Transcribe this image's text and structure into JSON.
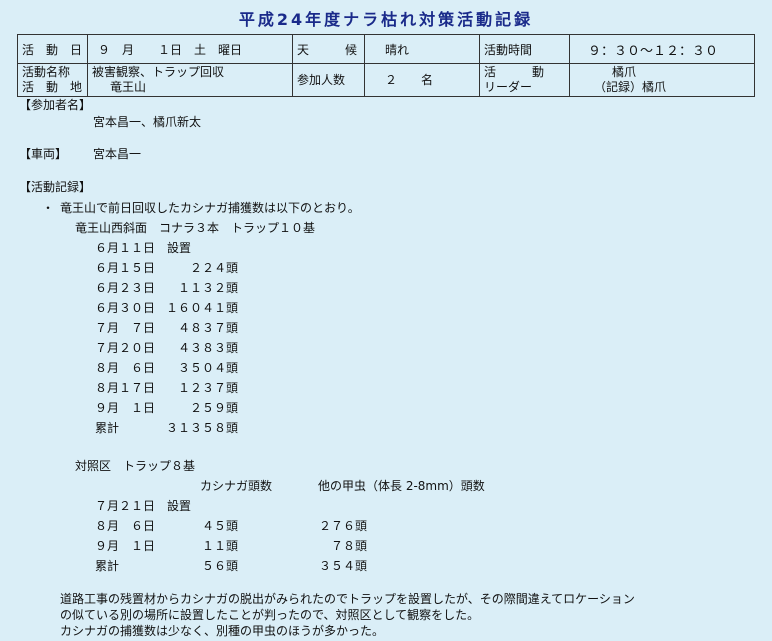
{
  "title": "平成24年度ナラ枯れ対策活動記録",
  "header": {
    "date_label": "活　動　日",
    "date_value": "９　月　　１日　土　曜日",
    "weather_label": "天　　　候",
    "weather_value": "晴れ",
    "time_label": "活動時間",
    "time_value": "９：３０〜１２：３０",
    "name_label": "活動名称",
    "place_label": "活　動　地",
    "name_value": "被害観察、トラップ回収",
    "place_value": "竜王山",
    "participants_label": "参加人数",
    "participants_value": "２　　名",
    "leader_label_1": "活　　　動",
    "leader_label_2": "リーダー",
    "leader_value_1": "橘爪",
    "leader_value_2": "（記録）橘爪"
  },
  "participants": {
    "heading": "【参加者名】",
    "names": "宮本昌一、橘爪新太"
  },
  "vehicle": {
    "heading": "【車両】",
    "value": "宮本昌一"
  },
  "record": {
    "heading": "【活動記録】",
    "bullet": "・",
    "intro": "竜王山で前日回収したカシナガ捕獲数は以下のとおり。",
    "site_a": "竜王山西斜面　コナラ３本　トラップ１０基",
    "rows_a": [
      {
        "date": "６月１１日",
        "value": "設置"
      },
      {
        "date": "６月１５日",
        "value": "２２４頭"
      },
      {
        "date": "６月２３日",
        "value": "１１３２頭"
      },
      {
        "date": "６月３０日",
        "value": "１６０４１頭"
      },
      {
        "date": "７月　７日",
        "value": "４８３７頭"
      },
      {
        "date": "７月２０日",
        "value": "４３８３頭"
      },
      {
        "date": "８月　６日",
        "value": "３５０４頭"
      },
      {
        "date": "８月１７日",
        "value": "１２３７頭"
      },
      {
        "date": "９月　１日",
        "value": "２５９頭"
      },
      {
        "date": "累計",
        "value": "３１３５８頭"
      }
    ],
    "site_b": "対照区　トラップ８基",
    "col_b1": "カシナガ頭数",
    "col_b2": "他の甲虫（体長 2-8mm）頭数",
    "rows_b": [
      {
        "date": "７月２１日",
        "v1": "設置",
        "v2": ""
      },
      {
        "date": "８月　６日",
        "v1": "４５頭",
        "v2": "２７６頭"
      },
      {
        "date": "９月　１日",
        "v1": "１１頭",
        "v2": "７８頭"
      },
      {
        "date": "累計",
        "v1": "５６頭",
        "v2": "３５４頭"
      }
    ],
    "note_1": "道路工事の残置材からカシナガの脱出がみられたのでトラップを設置したが、その際間違えてロケーション",
    "note_2": "の似ている別の場所に設置したことが判ったので、対照区として観察をした。",
    "note_3": "カシナガの捕獲数は少なく、別種の甲虫のほうが多かった。"
  }
}
